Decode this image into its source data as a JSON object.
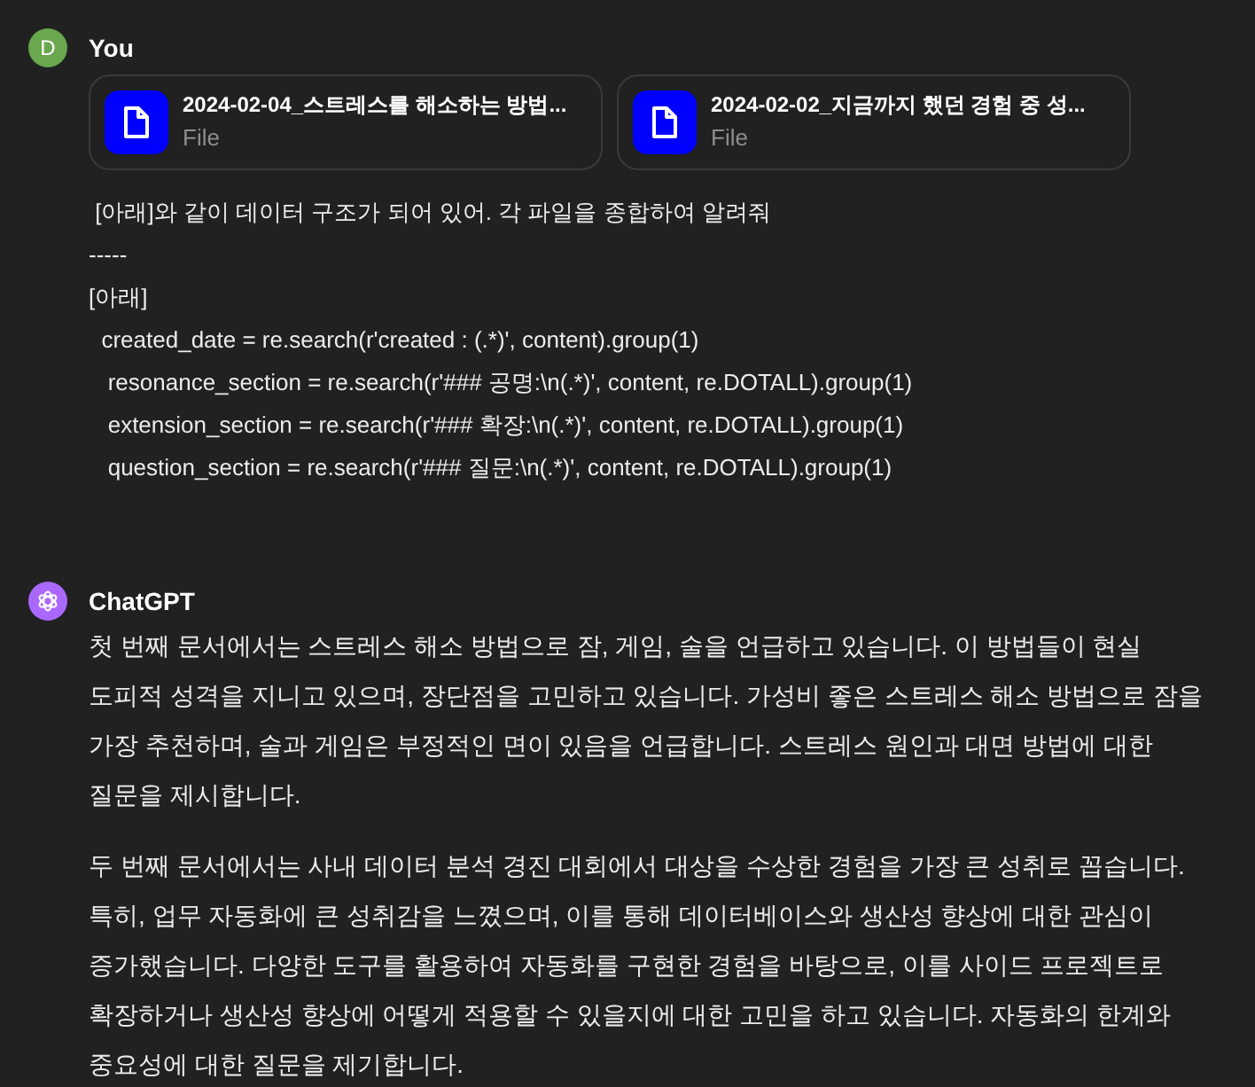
{
  "messages": [
    {
      "kind": "user",
      "avatar": "D",
      "author": "You",
      "files": [
        {
          "name": "2024-02-04_스트레스를 해소하는 방법...",
          "type": "File"
        },
        {
          "name": "2024-02-02_지금까지 했던 경험 중 성...",
          "type": "File"
        }
      ],
      "lines": [
        " [아래]와 같이 데이터 구조가 되어 있어. 각 파일을 종합하여 알려줘",
        "-----",
        "[아래]",
        "  created_date = re.search(r'created : (.*)', content).group(1)",
        "   resonance_section = re.search(r'### 공명:\\n(.*)', content, re.DOTALL).group(1)",
        "   extension_section = re.search(r'### 확장:\\n(.*)', content, re.DOTALL).group(1)",
        "   question_section = re.search(r'### 질문:\\n(.*)', content, re.DOTALL).group(1)"
      ]
    },
    {
      "kind": "assistant",
      "author": "ChatGPT",
      "paragraphs": [
        "첫 번째 문서에서는 스트레스 해소 방법으로 잠, 게임, 술을 언급하고 있습니다. 이 방법들이 현실 도피적 성격을 지니고 있으며, 장단점을 고민하고 있습니다. 가성비 좋은 스트레스 해소 방법으로 잠을 가장 추천하며, 술과 게임은 부정적인 면이 있음을 언급합니다. 스트레스 원인과 대면 방법에 대한 질문을 제시합니다.",
        "두 번째 문서에서는 사내 데이터 분석 경진 대회에서 대상을 수상한 경험을 가장 큰 성취로 꼽습니다. 특히, 업무 자동화에 큰 성취감을 느꼈으며, 이를 통해 데이터베이스와 생산성 향상에 대한 관심이 증가했습니다. 다양한 도구를 활용하여 자동화를 구현한 경험을 바탕으로, 이를 사이드 프로젝트로 확장하거나 생산성 향상에 어떻게 적용할 수 있을지에 대한 고민을 하고 있습니다. 자동화의 한계와 중요성에 대한 질문을 제기합니다."
      ]
    }
  ]
}
